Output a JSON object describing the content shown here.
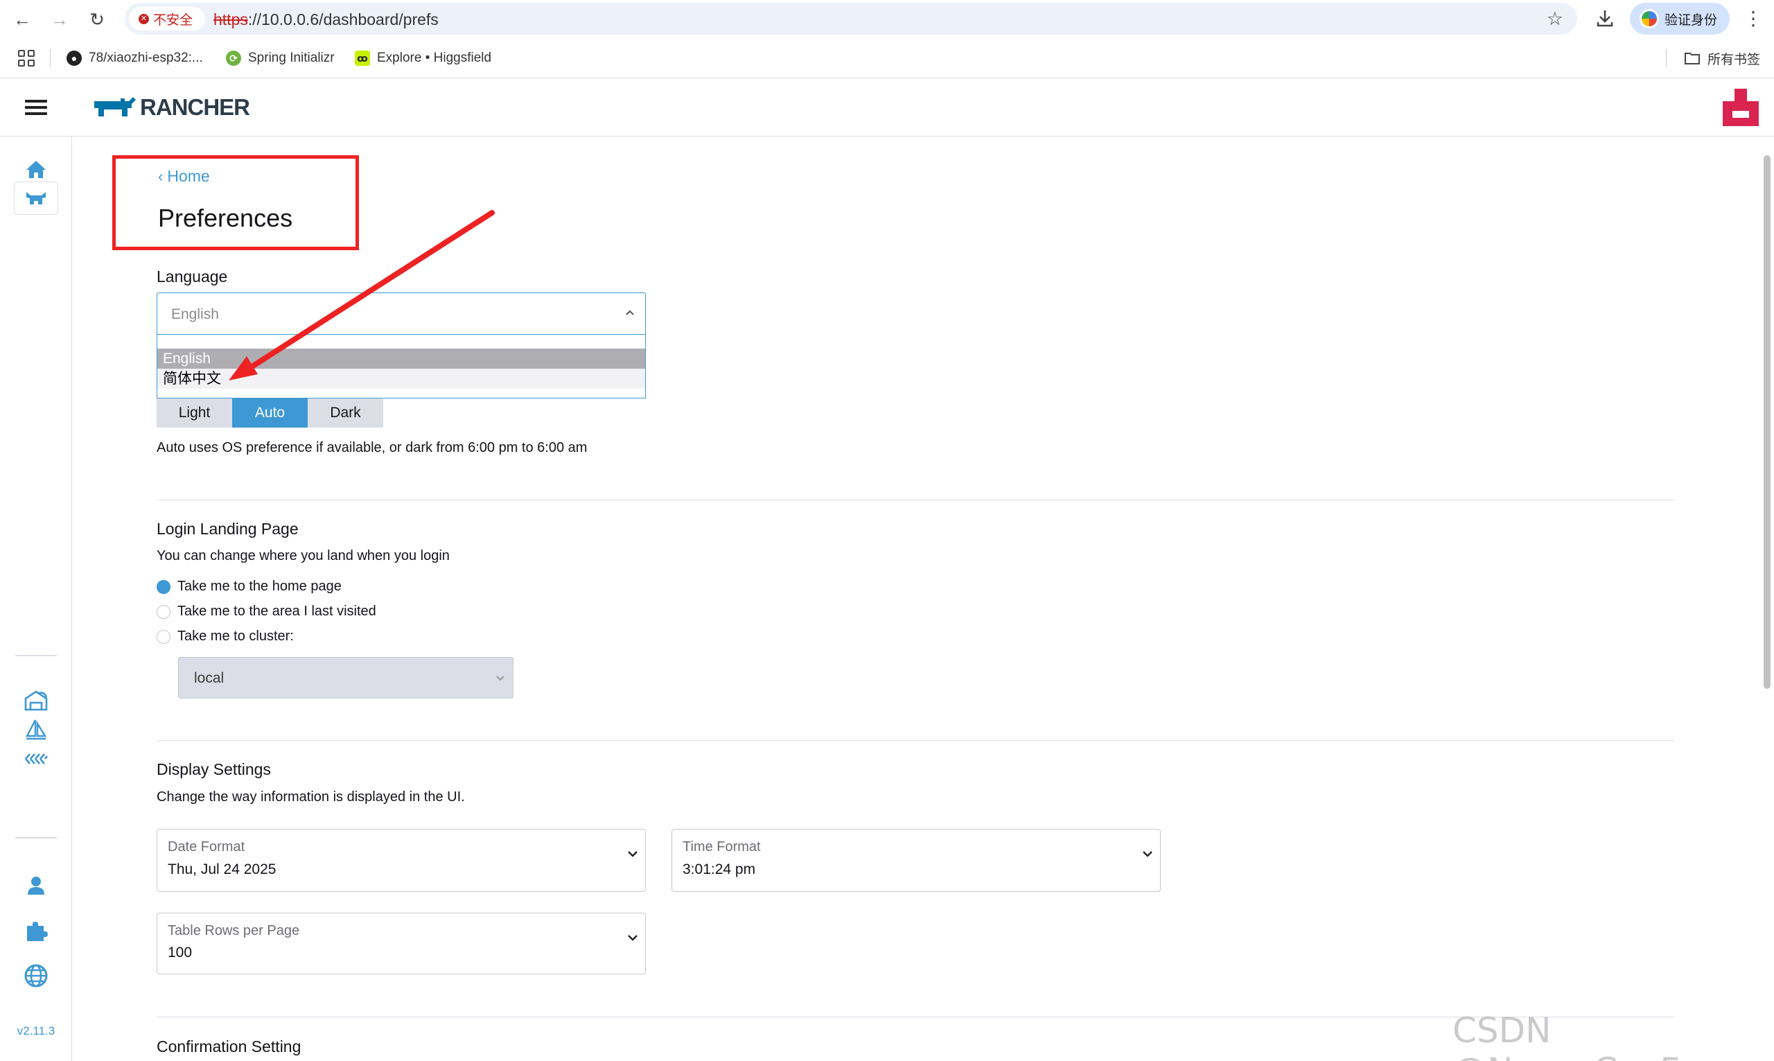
{
  "browser": {
    "insecure_label": "不安全",
    "url_scheme": "https",
    "url_rest": "://10.0.0.6/dashboard/prefs",
    "verify_label": "验证身份",
    "bookmarks": [
      {
        "label": "78/xiaozhi-esp32:..."
      },
      {
        "label": "Spring Initializr"
      },
      {
        "label": "Explore • Higgsfield"
      }
    ],
    "all_bookmarks": "所有书签"
  },
  "header": {
    "logo_text": "RANCHER"
  },
  "sidebar": {
    "version": "v2.11.3",
    "icons": [
      "home-icon",
      "cluster-cow-icon",
      "fleet-icon",
      "apps-sail-icon",
      "rancher-logo-small-icon",
      "users-icon",
      "extensions-puzzle-icon",
      "global-settings-icon"
    ]
  },
  "page": {
    "back_label": "Home",
    "title": "Preferences"
  },
  "language": {
    "label": "Language",
    "value": "English",
    "options": [
      "English",
      "简体中文"
    ]
  },
  "theme": {
    "options": [
      "Light",
      "Auto",
      "Dark"
    ],
    "selected": "Auto",
    "note": "Auto uses OS preference if available, or dark from 6:00 pm to 6:00 am"
  },
  "login": {
    "heading": "Login Landing Page",
    "description": "You can change where you land when you login",
    "options": [
      "Take me to the home page",
      "Take me to the area I last visited",
      "Take me to cluster:"
    ],
    "selected_index": 0,
    "cluster_value": "local"
  },
  "display": {
    "heading": "Display Settings",
    "description": "Change the way information is displayed in the UI.",
    "date_format_label": "Date Format",
    "date_format_value": "Thu, Jul 24 2025",
    "time_format_label": "Time Format",
    "time_format_value": "3:01:24 pm",
    "rows_label": "Table Rows per Page",
    "rows_value": "100"
  },
  "confirmation": {
    "heading": "Confirmation Setting"
  },
  "watermark": "CSDN @Nova_CaoFc",
  "colors": {
    "accent": "#3d98d3",
    "annotation": "#ee2222"
  }
}
